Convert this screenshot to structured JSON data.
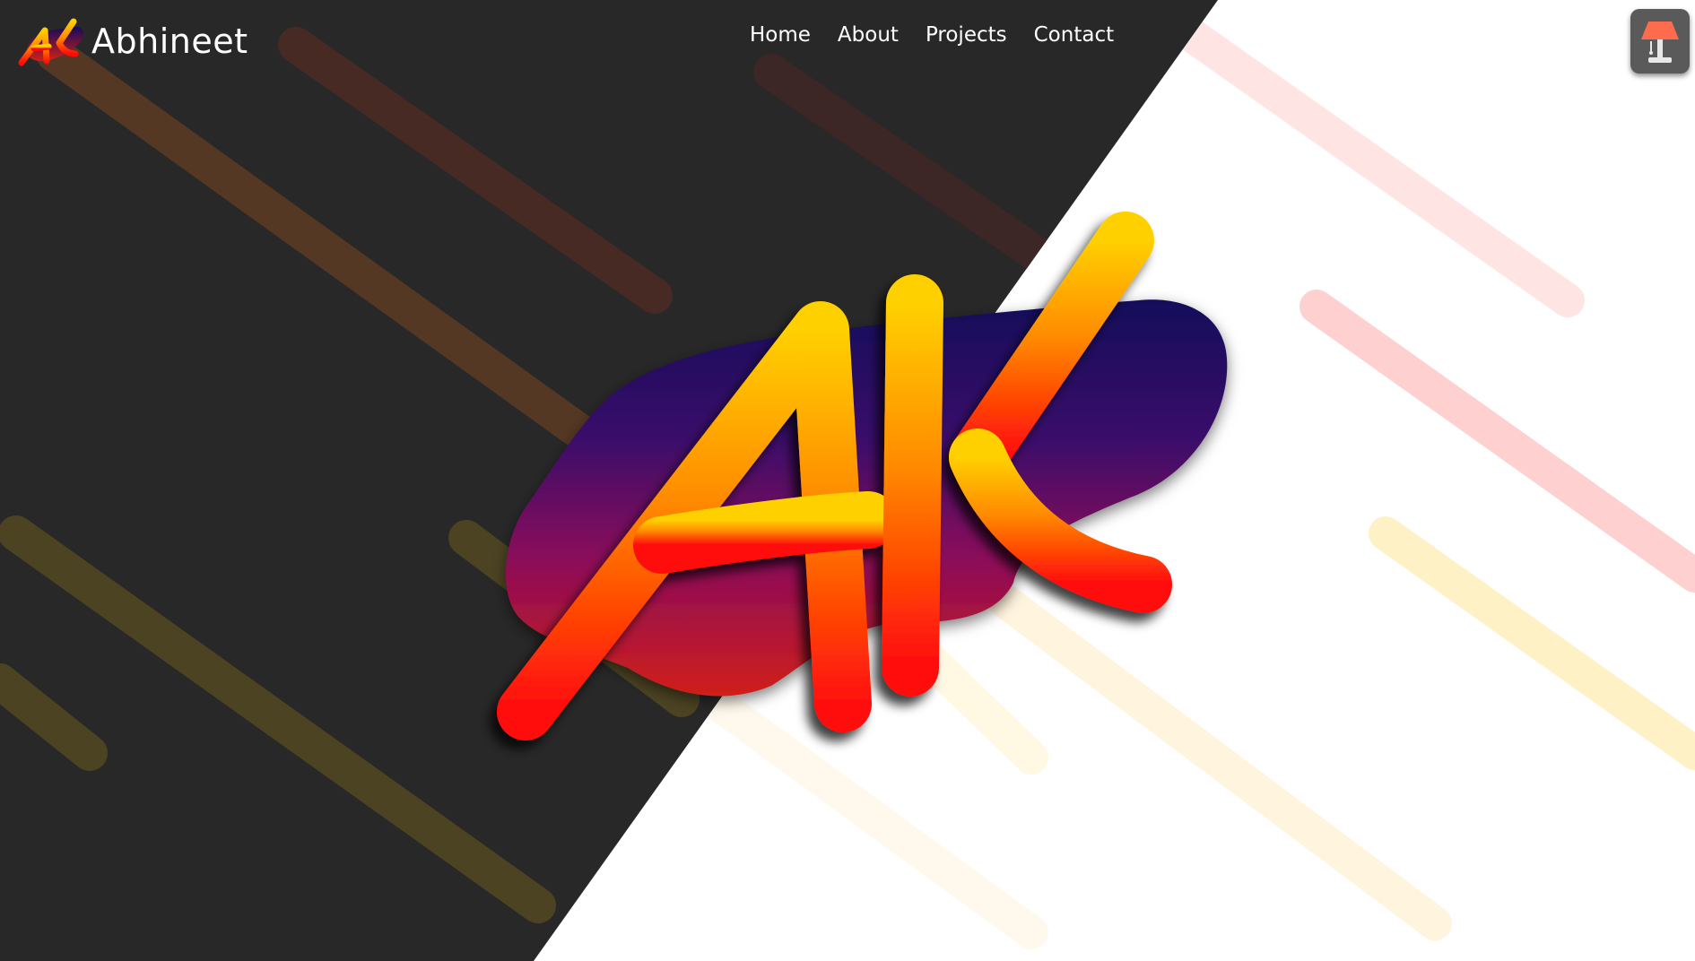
{
  "brand": {
    "name": "Abhineet",
    "logo_text": "AK"
  },
  "nav": {
    "items": [
      "Home",
      "About",
      "Projects",
      "Contact"
    ]
  },
  "hero": {
    "logo_text": "AK"
  },
  "theme_toggle": {
    "icon": "lamp-icon"
  },
  "colors": {
    "dark_bg": "#282828",
    "light_bg": "#ffffff",
    "accent_yellow": "#ffd000",
    "accent_orange": "#ff7a00",
    "accent_red": "#ff0a0a",
    "blob_top": "#140a5a",
    "blob_bottom": "#d0201a",
    "button_bg": "#5a5a5a",
    "lamp_shade": "#ff6b4d"
  }
}
